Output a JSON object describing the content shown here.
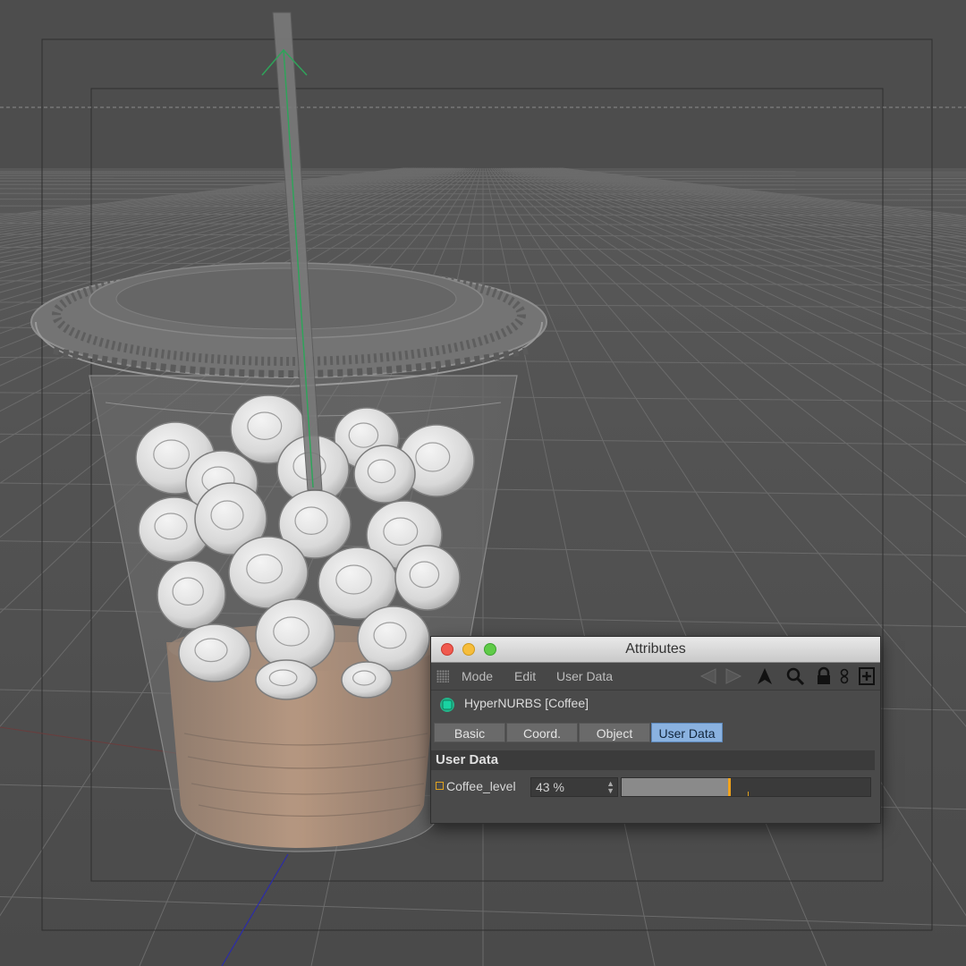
{
  "scene": {
    "object": "coffee cup with lid, straw, ice and coffee"
  },
  "attributes_window": {
    "title": "Attributes",
    "menu": [
      "Mode",
      "Edit",
      "User Data"
    ],
    "toolbar_icons": [
      "nav-arrows-icon",
      "pointer-arrow-icon",
      "search-icon",
      "lock-icon",
      "link-icon",
      "new-window-icon"
    ],
    "object_name": "HyperNURBS [Coffee]",
    "tabs": [
      {
        "label": "Basic",
        "active": false
      },
      {
        "label": "Coord.",
        "active": false
      },
      {
        "label": "Object",
        "active": false
      },
      {
        "label": "User Data",
        "active": true
      }
    ],
    "section_title": "User Data",
    "property": {
      "label": "Coffee_level",
      "value_text": "43 %",
      "value": 0.43
    }
  },
  "colors": {
    "viewport_bg": "#4d4d4d",
    "coffee": "#c99a76",
    "active_tab": "#8ab2e0",
    "slider_handle": "#f0a21b"
  }
}
